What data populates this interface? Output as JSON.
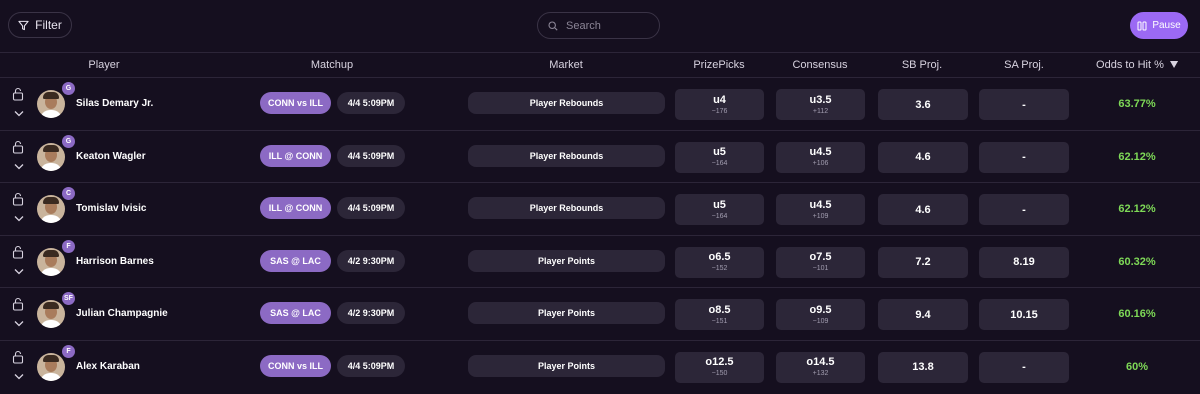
{
  "toolbar": {
    "filter_label": "Filter",
    "search_placeholder": "Search",
    "search_value": "",
    "pause_label": "Pause"
  },
  "headers": {
    "player": "Player",
    "matchup": "Matchup",
    "market": "Market",
    "prizepicks": "PrizePicks",
    "consensus": "Consensus",
    "sb_proj": "SB Proj.",
    "sa_proj": "SA Proj.",
    "odds_to_hit": "Odds to Hit %"
  },
  "rows": [
    {
      "player": "Silas Demary Jr.",
      "position": "G",
      "matchup": "CONN vs ILL",
      "time": "4/4 5:09PM",
      "market": "Player Rebounds",
      "pp_line": "u4",
      "pp_price": "−176",
      "cons_line": "u3.5",
      "cons_price": "+112",
      "sb_proj": "3.6",
      "sa_proj": "-",
      "hit": "63.77%"
    },
    {
      "player": "Keaton Wagler",
      "position": "G",
      "matchup": "ILL @ CONN",
      "time": "4/4 5:09PM",
      "market": "Player Rebounds",
      "pp_line": "u5",
      "pp_price": "−164",
      "cons_line": "u4.5",
      "cons_price": "+106",
      "sb_proj": "4.6",
      "sa_proj": "-",
      "hit": "62.12%"
    },
    {
      "player": "Tomislav Ivisic",
      "position": "C",
      "matchup": "ILL @ CONN",
      "time": "4/4 5:09PM",
      "market": "Player Rebounds",
      "pp_line": "u5",
      "pp_price": "−164",
      "cons_line": "u4.5",
      "cons_price": "+109",
      "sb_proj": "4.6",
      "sa_proj": "-",
      "hit": "62.12%"
    },
    {
      "player": "Harrison Barnes",
      "position": "F",
      "matchup": "SAS @ LAC",
      "time": "4/2 9:30PM",
      "market": "Player Points",
      "pp_line": "o6.5",
      "pp_price": "−152",
      "cons_line": "o7.5",
      "cons_price": "−101",
      "sb_proj": "7.2",
      "sa_proj": "8.19",
      "hit": "60.32%"
    },
    {
      "player": "Julian Champagnie",
      "position": "SF",
      "matchup": "SAS @ LAC",
      "time": "4/2 9:30PM",
      "market": "Player Points",
      "pp_line": "o8.5",
      "pp_price": "−151",
      "cons_line": "o9.5",
      "cons_price": "−109",
      "sb_proj": "9.4",
      "sa_proj": "10.15",
      "hit": "60.16%"
    },
    {
      "player": "Alex Karaban",
      "position": "F",
      "matchup": "CONN vs ILL",
      "time": "4/4 5:09PM",
      "market": "Player Points",
      "pp_line": "o12.5",
      "pp_price": "−150",
      "cons_line": "o14.5",
      "cons_price": "+132",
      "sb_proj": "13.8",
      "sa_proj": "-",
      "hit": "60%"
    }
  ],
  "colors": {
    "background": "#150f1f",
    "accent": "#9b69f4",
    "pill": "#8c6ac4",
    "cell": "#2c2638",
    "positive": "#7ed957"
  },
  "icons": [
    "filter-icon",
    "search-icon",
    "pause-icon",
    "sort-desc-icon",
    "lock-open-icon",
    "chevron-down-icon"
  ]
}
